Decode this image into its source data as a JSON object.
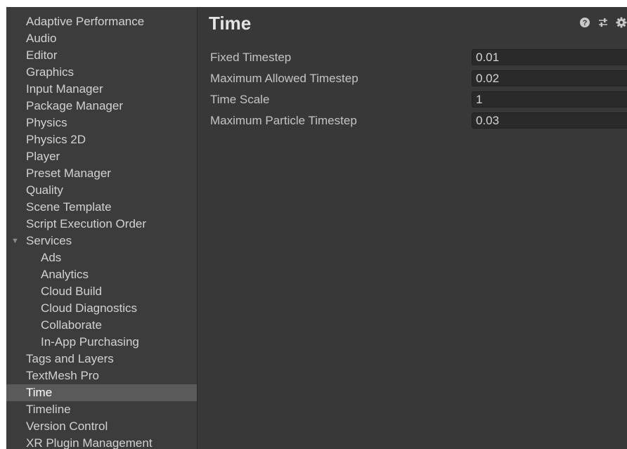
{
  "sidebar": {
    "items": [
      {
        "label": "Adaptive Performance"
      },
      {
        "label": "Audio"
      },
      {
        "label": "Editor"
      },
      {
        "label": "Graphics"
      },
      {
        "label": "Input Manager"
      },
      {
        "label": "Package Manager"
      },
      {
        "label": "Physics"
      },
      {
        "label": "Physics 2D"
      },
      {
        "label": "Player"
      },
      {
        "label": "Preset Manager"
      },
      {
        "label": "Quality"
      },
      {
        "label": "Scene Template"
      },
      {
        "label": "Script Execution Order"
      },
      {
        "label": "Services",
        "expanded": true
      },
      {
        "label": "Ads",
        "child": true
      },
      {
        "label": "Analytics",
        "child": true
      },
      {
        "label": "Cloud Build",
        "child": true
      },
      {
        "label": "Cloud Diagnostics",
        "child": true
      },
      {
        "label": "Collaborate",
        "child": true
      },
      {
        "label": "In-App Purchasing",
        "child": true
      },
      {
        "label": "Tags and Layers"
      },
      {
        "label": "TextMesh Pro"
      },
      {
        "label": "Time",
        "selected": true
      },
      {
        "label": "Timeline"
      },
      {
        "label": "Version Control"
      },
      {
        "label": "XR Plugin Management"
      }
    ]
  },
  "main": {
    "title": "Time",
    "header_icons": [
      "help-icon",
      "preset-icon",
      "settings-gear-icon"
    ],
    "properties": [
      {
        "label": "Fixed Timestep",
        "value": "0.01"
      },
      {
        "label": "Maximum Allowed Timestep",
        "value": "0.02"
      },
      {
        "label": "Time Scale",
        "value": "1"
      },
      {
        "label": "Maximum Particle Timestep",
        "value": "0.03"
      }
    ]
  },
  "colors": {
    "background": "#383838",
    "sidebar": "#3c3c3c",
    "selected_row": "#5a5a5a",
    "field": "#2a2a2a",
    "text": "#d2d2d2"
  }
}
